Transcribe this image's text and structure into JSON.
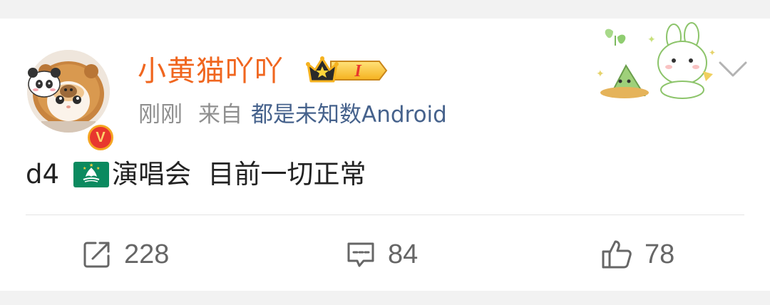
{
  "post": {
    "username": "小黄猫吖吖",
    "member_level": "I",
    "timestamp": "刚刚",
    "source_prefix": "来自",
    "source": "都是未知数Android",
    "content_prefix": "d4",
    "content_rest": "演唱会  目前一切正常",
    "flag_icon": "macau-flag-icon",
    "verified_mark": "V"
  },
  "actions": {
    "repost_count": "228",
    "comment_count": "84",
    "like_count": "78"
  },
  "colors": {
    "username": "#f0661f",
    "source_link": "#46628c",
    "meta": "#8f8f8f",
    "text": "#222222",
    "action": "#666666"
  }
}
